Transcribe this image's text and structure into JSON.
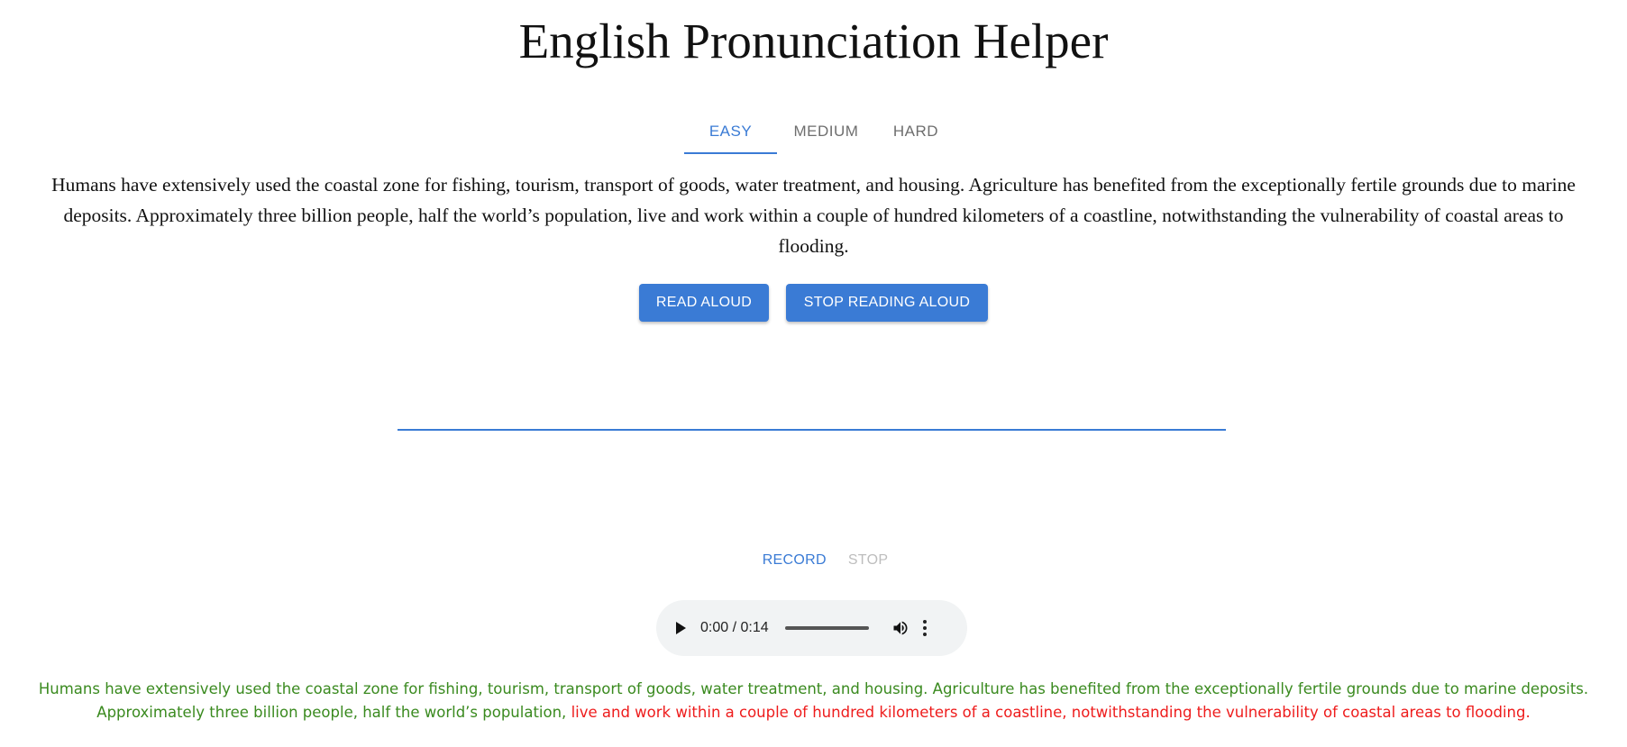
{
  "title": "English Pronunciation Helper",
  "tabs": [
    {
      "label": "EASY",
      "active": true
    },
    {
      "label": "MEDIUM",
      "active": false
    },
    {
      "label": "HARD",
      "active": false
    }
  ],
  "passage": "Humans have extensively used the coastal zone for fishing, tourism, transport of goods, water treatment, and housing. Agriculture has benefited from the exceptionally fertile grounds due to marine deposits. Approximately three billion people, half the world’s population, live and work within a couple of hundred kilometers of a coastline, notwithstanding the vulnerability of coastal areas to flooding.",
  "buttons": {
    "read_aloud": "READ ALOUD",
    "stop_reading": "STOP READING ALOUD"
  },
  "recorder": {
    "record_label": "RECORD",
    "stop_label": "STOP"
  },
  "audio": {
    "time": "0:00 / 0:14"
  },
  "result": {
    "correct_text": "Humans have extensively used the coastal zone for fishing, tourism, transport of goods, water treatment, and housing. Agriculture has benefited from the exceptionally fertile grounds due to marine deposits. Approximately three billion people, half the world’s population, ",
    "incorrect_text": "live and work within a couple of hundred kilometers of a coastline, notwithstanding the vulnerability of coastal areas to flooding.",
    "correct_color": "#3a8a1f",
    "incorrect_color": "#ee1c1c"
  },
  "colors": {
    "accent": "#3a7bd5",
    "disabled": "#bdbdbd"
  }
}
